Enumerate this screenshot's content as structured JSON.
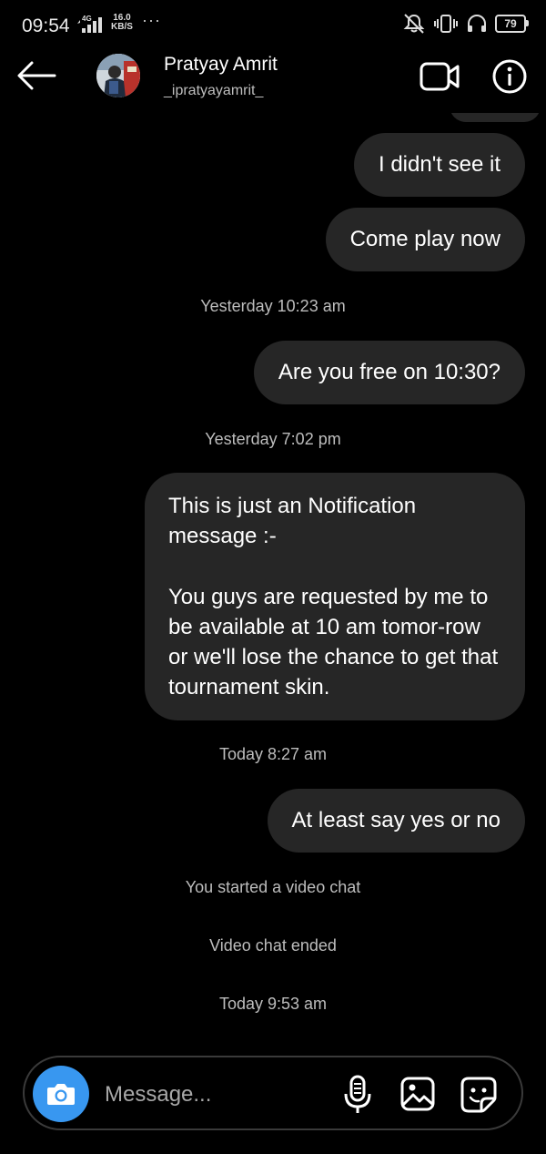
{
  "status_bar": {
    "time": "09:54",
    "network": "4G",
    "speed_value": "16.0",
    "speed_unit": "KB/S",
    "more": "···",
    "battery": "79"
  },
  "header": {
    "name": "Pratyay Amrit",
    "username": "_ipratyayamrit_",
    "icons": [
      "back-arrow-icon",
      "avatar",
      "video-camera-icon",
      "info-icon"
    ]
  },
  "chat": {
    "messages": [
      {
        "text": "I didn't see it"
      },
      {
        "text": "Come play now"
      },
      {
        "timestamp": "Yesterday 10:23 am"
      },
      {
        "text": "Are you free on 10:30?"
      },
      {
        "timestamp": "Yesterday 7:02 pm"
      },
      {
        "paragraph1": "This is just an Notification message :-",
        "paragraph2": "You guys are requested by me to be available at 10 am tomor-row or we'll lose the chance to get that tournament skin."
      },
      {
        "timestamp": "Today 8:27 am"
      },
      {
        "text": "At least say yes or no"
      },
      {
        "event": "You started a video chat"
      },
      {
        "event": "Video chat ended"
      },
      {
        "timestamp": "Today 9:53 am"
      }
    ]
  },
  "composer": {
    "placeholder": "Message...",
    "icons": [
      "camera-icon",
      "microphone-icon",
      "gallery-icon",
      "sticker-icon"
    ]
  },
  "colors": {
    "background": "#000000",
    "bubble": "#262626",
    "accent": "#3897f0",
    "muted_text": "#bdbdbd"
  }
}
